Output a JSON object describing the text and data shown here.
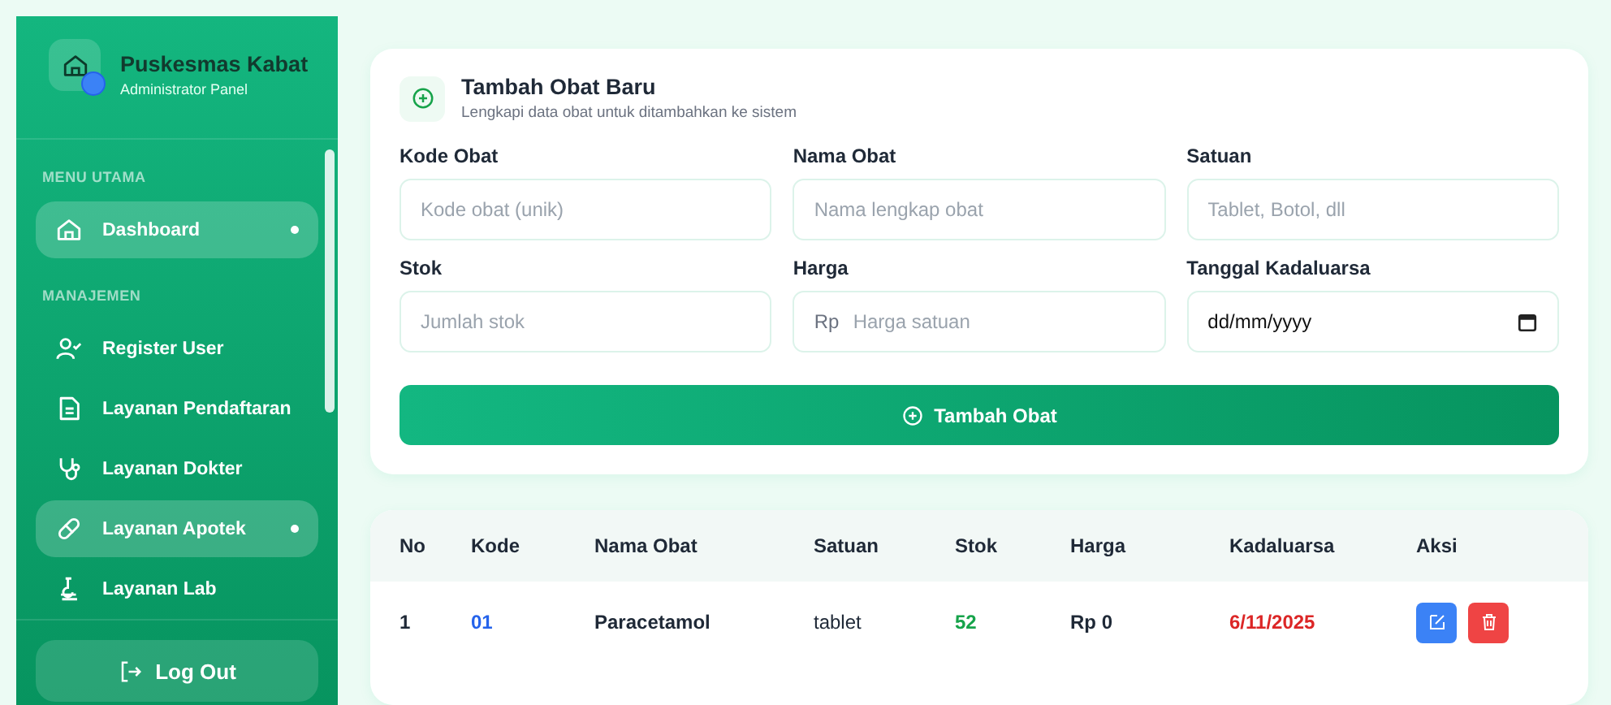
{
  "sidebar": {
    "brand": {
      "title": "Puskesmas Kabat",
      "subtitle": "Administrator Panel"
    },
    "sections": [
      {
        "heading": "MENU UTAMA",
        "items": [
          {
            "label": "Dashboard",
            "kind": "home",
            "selected": true
          }
        ]
      },
      {
        "heading": "MANAJEMEN",
        "items": [
          {
            "label": "Register User",
            "kind": "user",
            "selected": false
          },
          {
            "label": "Layanan Pendaftaran",
            "kind": "file",
            "selected": false
          },
          {
            "label": "Layanan Dokter",
            "kind": "stethoscope",
            "selected": false
          },
          {
            "label": "Layanan Apotek",
            "kind": "pill",
            "selected": true
          },
          {
            "label": "Layanan Lab",
            "kind": "lab",
            "selected": false
          }
        ]
      }
    ],
    "logout": "Log Out"
  },
  "form": {
    "title": "Tambah Obat Baru",
    "subtitle": "Lengkapi data obat untuk ditambahkan ke sistem",
    "fields": [
      {
        "label": "Kode Obat",
        "placeholder": "Kode obat (unik)",
        "kind": "text"
      },
      {
        "label": "Nama Obat",
        "placeholder": "Nama lengkap obat",
        "kind": "text"
      },
      {
        "label": "Satuan",
        "placeholder": "Tablet, Botol, dll",
        "kind": "text"
      },
      {
        "label": "Stok",
        "placeholder": "Jumlah stok",
        "kind": "text"
      },
      {
        "label": "Harga",
        "prefix": "Rp",
        "placeholder": "Harga satuan",
        "kind": "money"
      },
      {
        "label": "Tanggal Kadaluarsa",
        "value": "dd/mm/yyyy",
        "kind": "date"
      }
    ],
    "submit": "Tambah Obat"
  },
  "table": {
    "columns": [
      "No",
      "Kode",
      "Nama Obat",
      "Satuan",
      "Stok",
      "Harga",
      "Kadaluarsa",
      "Aksi"
    ],
    "rows": [
      {
        "no": "1",
        "kode": "01",
        "nama": "Paracetamol",
        "satuan": "tablet",
        "stok": "52",
        "harga": "Rp 0",
        "kadaluarsa": "6/11/2025"
      }
    ]
  }
}
